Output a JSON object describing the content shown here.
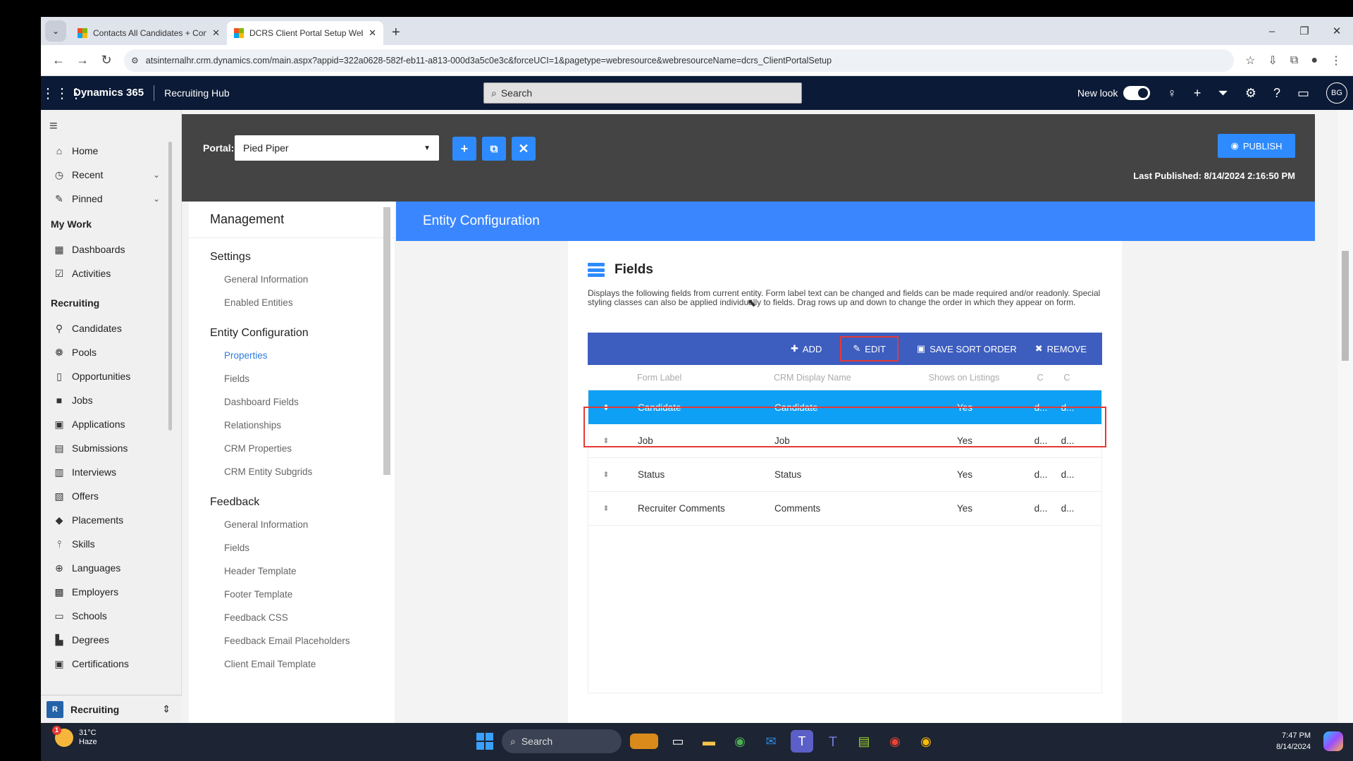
{
  "browser": {
    "tabs": [
      {
        "title": "Contacts All Candidates + Cont",
        "active": false
      },
      {
        "title": "DCRS Client Portal Setup Web",
        "active": true
      }
    ],
    "url": "atsinternalhr.crm.dynamics.com/main.aspx?appid=322a0628-582f-eb11-a813-000d3a5c0e3c&forceUCI=1&pagetype=webresource&webresourceName=dcrs_ClientPortalSetup"
  },
  "header": {
    "brand": "Dynamics 365",
    "app": "Recruiting Hub",
    "search_placeholder": "Search",
    "new_look": "New look",
    "avatar": "BG"
  },
  "sitemap": {
    "top": [
      {
        "label": "Home",
        "icon": "home-icon"
      },
      {
        "label": "Recent",
        "icon": "clock-icon"
      },
      {
        "label": "Pinned",
        "icon": "pin-icon"
      }
    ],
    "my_work": "My Work",
    "my_work_items": [
      {
        "label": "Dashboards",
        "icon": "dashboard-icon"
      },
      {
        "label": "Activities",
        "icon": "activities-icon"
      }
    ],
    "recruiting": "Recruiting",
    "recruiting_items": [
      {
        "label": "Candidates",
        "icon": "person-icon"
      },
      {
        "label": "Pools",
        "icon": "pool-icon"
      },
      {
        "label": "Opportunities",
        "icon": "opportunity-icon"
      },
      {
        "label": "Jobs",
        "icon": "briefcase-icon"
      },
      {
        "label": "Applications",
        "icon": "application-icon"
      },
      {
        "label": "Submissions",
        "icon": "submission-icon"
      },
      {
        "label": "Interviews",
        "icon": "calendar-icon"
      },
      {
        "label": "Offers",
        "icon": "offer-icon"
      },
      {
        "label": "Placements",
        "icon": "placement-icon"
      },
      {
        "label": "Skills",
        "icon": "skills-icon"
      },
      {
        "label": "Languages",
        "icon": "globe-icon"
      },
      {
        "label": "Employers",
        "icon": "building-icon"
      },
      {
        "label": "Schools",
        "icon": "school-icon"
      },
      {
        "label": "Degrees",
        "icon": "degree-icon"
      },
      {
        "label": "Certifications",
        "icon": "certificate-icon"
      }
    ],
    "area": {
      "badge": "R",
      "label": "Recruiting"
    }
  },
  "portal": {
    "label": "Portal:",
    "selected": "Pied Piper",
    "publish": "PUBLISH",
    "last_published": "Last Published: 8/14/2024 2:16:50 PM"
  },
  "management": {
    "title": "Management",
    "sections": [
      {
        "title": "Settings",
        "items": [
          "General Information",
          "Enabled Entities"
        ]
      },
      {
        "title": "Entity Configuration",
        "items": [
          "Properties",
          "Fields",
          "Dashboard Fields",
          "Relationships",
          "CRM Properties",
          "CRM Entity Subgrids"
        ]
      },
      {
        "title": "Feedback",
        "items": [
          "General Information",
          "Fields",
          "Header Template",
          "Footer Template",
          "Feedback CSS",
          "Feedback Email Placeholders",
          "Client Email Template"
        ]
      }
    ],
    "active_item": "Properties"
  },
  "entity_config": {
    "title": "Entity Configuration",
    "fields_title": "Fields",
    "fields_desc": "Displays the following fields from current entity. Form label text can be changed and fields can be made required and/or readonly. Special styling classes can also be applied individually to fields. Drag rows up and down to change the order in which they appear on form.",
    "toolbar": {
      "add": "ADD",
      "edit": "EDIT",
      "save_sort": "SAVE SORT ORDER",
      "remove": "REMOVE"
    },
    "columns": [
      "Form Label",
      "CRM Display Name",
      "Shows on Listings",
      "C",
      "C"
    ],
    "rows": [
      {
        "form_label": "Candidate",
        "crm_name": "Candidate",
        "listings": "Yes",
        "c1": "d...",
        "c2": "d...",
        "selected": true
      },
      {
        "form_label": "Job",
        "crm_name": "Job",
        "listings": "Yes",
        "c1": "d...",
        "c2": "d...",
        "selected": false
      },
      {
        "form_label": "Status",
        "crm_name": "Status",
        "listings": "Yes",
        "c1": "d...",
        "c2": "d...",
        "selected": false
      },
      {
        "form_label": "Recruiter Comments",
        "crm_name": "Comments",
        "listings": "Yes",
        "c1": "d...",
        "c2": "d...",
        "selected": false
      }
    ]
  },
  "taskbar": {
    "temp": "31°C",
    "weather": "Haze",
    "search": "Search",
    "time": "7:47 PM",
    "date": "8/14/2024"
  }
}
